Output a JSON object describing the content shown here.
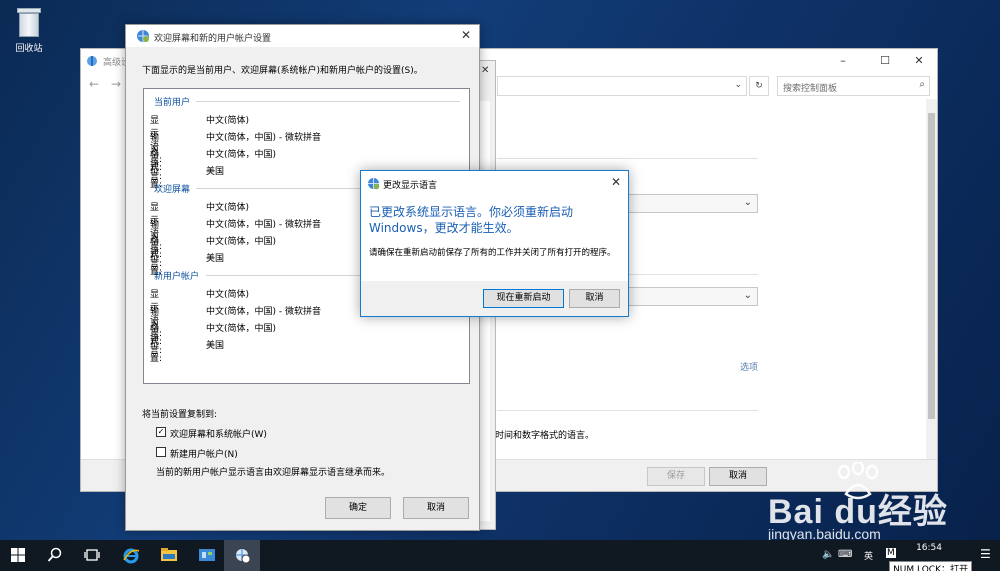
{
  "desktop": {
    "recycle_bin_label": "回收站"
  },
  "control_panel": {
    "title": "高级设",
    "search_placeholder": "搜索控制面板",
    "options_link": "选项",
    "hint_text": "时间和数字格式的语言。",
    "save_label": "保存",
    "cancel_label": "取消"
  },
  "welcome_dialog": {
    "title": "欢迎屏幕和新的用户帐户设置",
    "intro": "下面显示的是当前用户、欢迎屏幕(系统帐户)和新用户帐户的设置(S)。",
    "groups": [
      {
        "name": "当前用户",
        "rows": [
          {
            "key": "显示语言:",
            "value": "中文(简体)"
          },
          {
            "key": "输入语言:",
            "value": "中文(简体，中国) - 微软拼音"
          },
          {
            "key": "格式:",
            "value": "中文(简体，中国)"
          },
          {
            "key": "位置:",
            "value": "美国"
          }
        ]
      },
      {
        "name": "欢迎屏幕",
        "rows": [
          {
            "key": "显示语言:",
            "value": "中文(简体)"
          },
          {
            "key": "输入语言:",
            "value": "中文(简体，中国) - 微软拼音"
          },
          {
            "key": "格式:",
            "value": "中文(简体，中国)"
          },
          {
            "key": "位置:",
            "value": "美国"
          }
        ]
      },
      {
        "name": "新用户帐户",
        "rows": [
          {
            "key": "显示语言:",
            "value": "中文(简体)"
          },
          {
            "key": "输入语言:",
            "value": "中文(简体，中国) - 微软拼音"
          },
          {
            "key": "格式:",
            "value": "中文(简体，中国)"
          },
          {
            "key": "位置:",
            "value": "美国"
          }
        ]
      }
    ],
    "copy_to_label": "将当前设置复制到:",
    "checkbox_welcome": {
      "label": "欢迎屏幕和系统帐户(W)",
      "checked": true,
      "mark": "✓"
    },
    "checkbox_new_user": {
      "label": "新建用户帐户(N)",
      "checked": false
    },
    "note": "当前的新用户帐户显示语言由欢迎屏幕显示语言继承而来。",
    "ok_label": "确定",
    "cancel_label": "取消"
  },
  "change_dialog": {
    "title": "更改显示语言",
    "headline": "已更改系统显示语言。你必须重新启动 Windows，更改才能生效。",
    "body": "请确保在重新启动前保存了所有的工作并关闭了所有打开的程序。",
    "restart_label": "现在重新启动",
    "cancel_label": "取消"
  },
  "taskbar": {
    "ime_label": "英",
    "ime_mode": "M",
    "time": "16:54",
    "notifications_label": "☰"
  },
  "overlay": {
    "numlock": "NUM LOCK：打开"
  },
  "watermark": {
    "brand": "Bai  du经验",
    "url": "jingyan.baidu.com"
  },
  "colors": {
    "accent": "#0078d7",
    "headline_blue": "#1a5fb4",
    "group_blue": "#0b4f9e"
  }
}
